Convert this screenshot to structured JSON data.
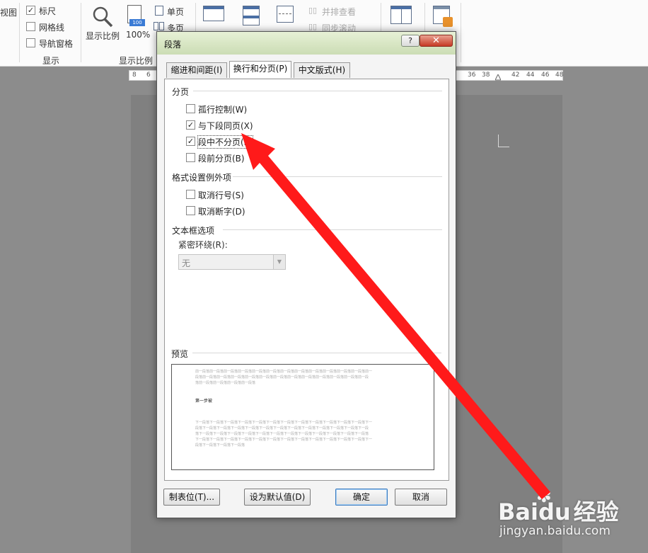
{
  "ribbon": {
    "view_label": "视图",
    "show_group": {
      "label": "显示",
      "ruler": "标尺",
      "ruler_checked": true,
      "gridlines": "网格线",
      "gridlines_checked": false,
      "nav_pane": "导航窗格",
      "nav_pane_checked": false
    },
    "zoom_group": {
      "label": "显示比例",
      "zoom_button": "显示比例",
      "zoom_100": "100%",
      "zoom_100_icon_text": "100",
      "single_page": "单页",
      "multi_page": "多页"
    },
    "window_group": {
      "side_by_side": "并排查看",
      "sync_scroll": "同步滚动"
    }
  },
  "ruler": {
    "left_ticks": [
      "8",
      "6"
    ],
    "right_ticks": [
      "36",
      "38",
      "42",
      "44",
      "46",
      "48"
    ]
  },
  "dialog": {
    "title": "段落",
    "help_label": "?",
    "close_label": "✕",
    "tabs": [
      {
        "label": "缩进和间距(I)",
        "active": false
      },
      {
        "label": "换行和分页(P)",
        "active": true
      },
      {
        "label": "中文版式(H)",
        "active": false
      }
    ],
    "pagination": {
      "title": "分页",
      "widow_control": "孤行控制(W)",
      "widow_control_checked": false,
      "keep_with_next": "与下段同页(X)",
      "keep_with_next_checked": true,
      "keep_lines_together": "段中不分页(K)",
      "keep_lines_together_checked": true,
      "page_break_before": "段前分页(B)",
      "page_break_before_checked": false
    },
    "exceptions": {
      "title": "格式设置例外项",
      "suppress_line_numbers": "取消行号(S)",
      "suppress_line_numbers_checked": false,
      "no_hyphenation": "取消断字(D)",
      "no_hyphenation_checked": false
    },
    "textbox": {
      "title": "文本框选项",
      "tight_wrap_label": "紧密环绕(R):",
      "tight_wrap_value": "无"
    },
    "preview": {
      "title": "预览",
      "prev_lines": [
        "前一段落前一段落前一段落前一段落前一段落前一段落前一段落前一段落前一段落前一段落前一段落前一段落前一",
        "段落前一段落前一段落前一段落前一段落前一段落前一段落前一段落前一段落前一段落前一段落前一段落前一段",
        "落前一段落前一段落前一段落前一段落"
      ],
      "sample_text": "第一步被",
      "next_lines": [
        "下一段落下一段落下一段落下一段落下一段落下一段落下一段落下一段落下一段落下一段落下一段落下一段落下一",
        "段落下一段落下一段落下一段落下一段落下一段落下一段落下一段落下一段落下一段落下一段落下一段落下一段",
        "落下一段落下一段落下一段落下一段落下一段落下一段落下一段落下一段落下一段落下一段落下一段落下一段落",
        "下一段落下一段落下一段落下一段落下一段落下一段落下一段落下一段落下一段落下一段落下一段落下一段落下一",
        "段落下一段落下一段落下一段落"
      ]
    },
    "buttons": {
      "tabs": "制表位(T)...",
      "set_default": "设为默认值(D)",
      "ok": "确定",
      "cancel": "取消"
    }
  },
  "watermark": {
    "logo_text": "Bai",
    "logo_char": "du",
    "logo_suffix": "经验",
    "url": "jingyan.baidu.com"
  },
  "annotation": {
    "arrow_color": "#ff1a1a"
  }
}
